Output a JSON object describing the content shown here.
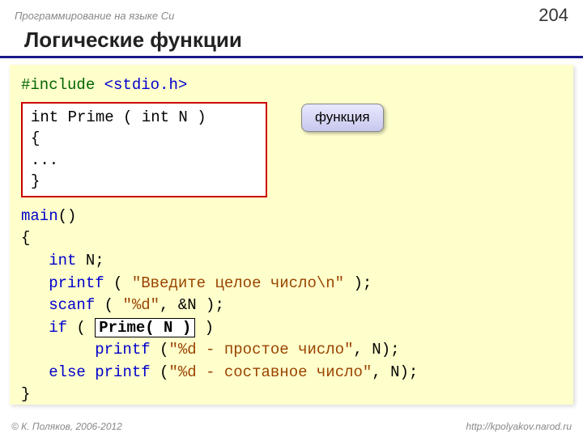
{
  "header": {
    "course": "Программирование на языке Си",
    "page": "204"
  },
  "title": "Логические функции",
  "code": {
    "include_kw": "#include ",
    "include_lib": "<stdio.h>",
    "funcbox_l1": "int Prime ( int N )",
    "funcbox_l2": "{",
    "funcbox_l3": "...",
    "funcbox_l4": "}",
    "main_kw": "main",
    "main_paren": "()",
    "brace_open": "{",
    "decl_kw": "   int",
    "decl_rest": " N;",
    "printf1_kw": "   printf",
    "printf1_paren1": " ( ",
    "printf1_str": "\"Введите целое число\\n\"",
    "printf1_paren2": " );",
    "scanf_kw": "   scanf",
    "scanf_paren1": " ( ",
    "scanf_str": "\"%d\"",
    "scanf_rest": ", &N );",
    "if_kw": "   if",
    "if_open": " ( ",
    "prime_call": "Prime( N )",
    "if_close": " )",
    "printf2_kw": "        printf",
    "printf2_open": " (",
    "printf2_str": "\"%d - простое число\"",
    "printf2_rest": ", N);",
    "else_kw": "   else",
    "else_sp": " ",
    "printf3_kw": "printf",
    "printf3_open": " (",
    "printf3_str": "\"%d - составное число\"",
    "printf3_rest": ", N);",
    "brace_close": "}"
  },
  "callout": "функция",
  "footer": {
    "copyright": "© К. Поляков, 2006-2012",
    "url": "http://kpolyakov.narod.ru"
  }
}
